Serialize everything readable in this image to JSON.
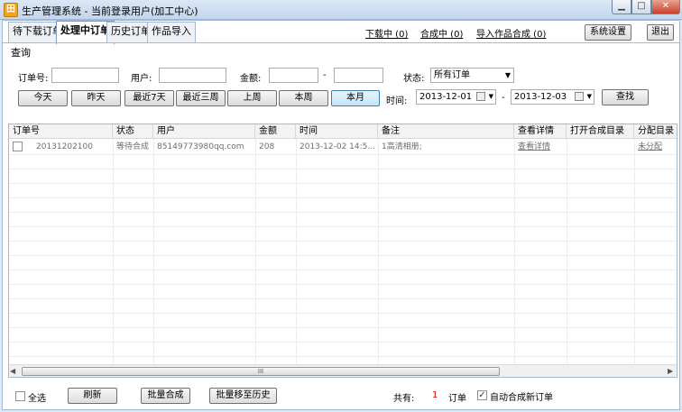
{
  "window": {
    "title": "生产管理系统 - 当前登录用户(加工中心)",
    "app_icon_glyph": "田",
    "min_glyph": "▁",
    "max_glyph": "□",
    "close_glyph": "✕"
  },
  "tabs": [
    {
      "label": "待下载订单",
      "active": false
    },
    {
      "label": "处理中订单",
      "active": true
    },
    {
      "label": "历史订单",
      "active": false
    },
    {
      "label": "作品导入",
      "active": false
    }
  ],
  "header_links": {
    "downloading": "下载中 (0)",
    "compositing": "合成中 (0)",
    "import_compositing": "导入作品合成 (0)"
  },
  "header_buttons": {
    "settings": "系统设置",
    "exit": "退出"
  },
  "query": {
    "section_label": "查询",
    "order_no_label": "订单号:",
    "order_no_value": "",
    "user_label": "用户:",
    "user_value": "",
    "amount_label": "金额:",
    "amount_from": "",
    "amount_dash": "-",
    "amount_to": "",
    "status_label": "状态:",
    "status_selected": "所有订单",
    "time_label": "时间:",
    "date_from": "2013-12-01",
    "date_dash": "-",
    "date_to": "2013-12-03",
    "search_button": "查找",
    "quick_buttons": [
      {
        "label": "今天",
        "selected": false
      },
      {
        "label": "昨天",
        "selected": false
      },
      {
        "label": "最近7天",
        "selected": false
      },
      {
        "label": "最近三周",
        "selected": false
      },
      {
        "label": "上周",
        "selected": false
      },
      {
        "label": "本周",
        "selected": false
      },
      {
        "label": "本月",
        "selected": true
      }
    ]
  },
  "grid": {
    "columns": [
      "订单号",
      "状态",
      "用户",
      "金额",
      "时间",
      "备注",
      "查看详情",
      "打开合成目录",
      "分配目录"
    ],
    "rows": [
      {
        "checked": false,
        "order_no": "20131202100",
        "status": "等待合成",
        "user": "85149773980qq.com",
        "amount": "208",
        "time": "2013-12-02 14:5...",
        "note": "1高清相册;",
        "details": "查看详情",
        "open_dir": "",
        "assign_dir": "未分配"
      }
    ],
    "scroll_left_glyph": "◀",
    "scroll_right_glyph": "▶",
    "scroll_thumb_grip": "III"
  },
  "footer": {
    "select_all": "全选",
    "refresh": "刷新",
    "batch_composite": "批量合成",
    "batch_move_history": "批量移至历史",
    "total_label": "共有:",
    "total_count": "1",
    "total_unit": "订单",
    "auto_composite_label": "自动合成新订单",
    "auto_composite_checked": true
  },
  "colors": {
    "accent_red": "#c8412b",
    "count_red": "#d40000",
    "window_bg": "#dfe9f5"
  }
}
